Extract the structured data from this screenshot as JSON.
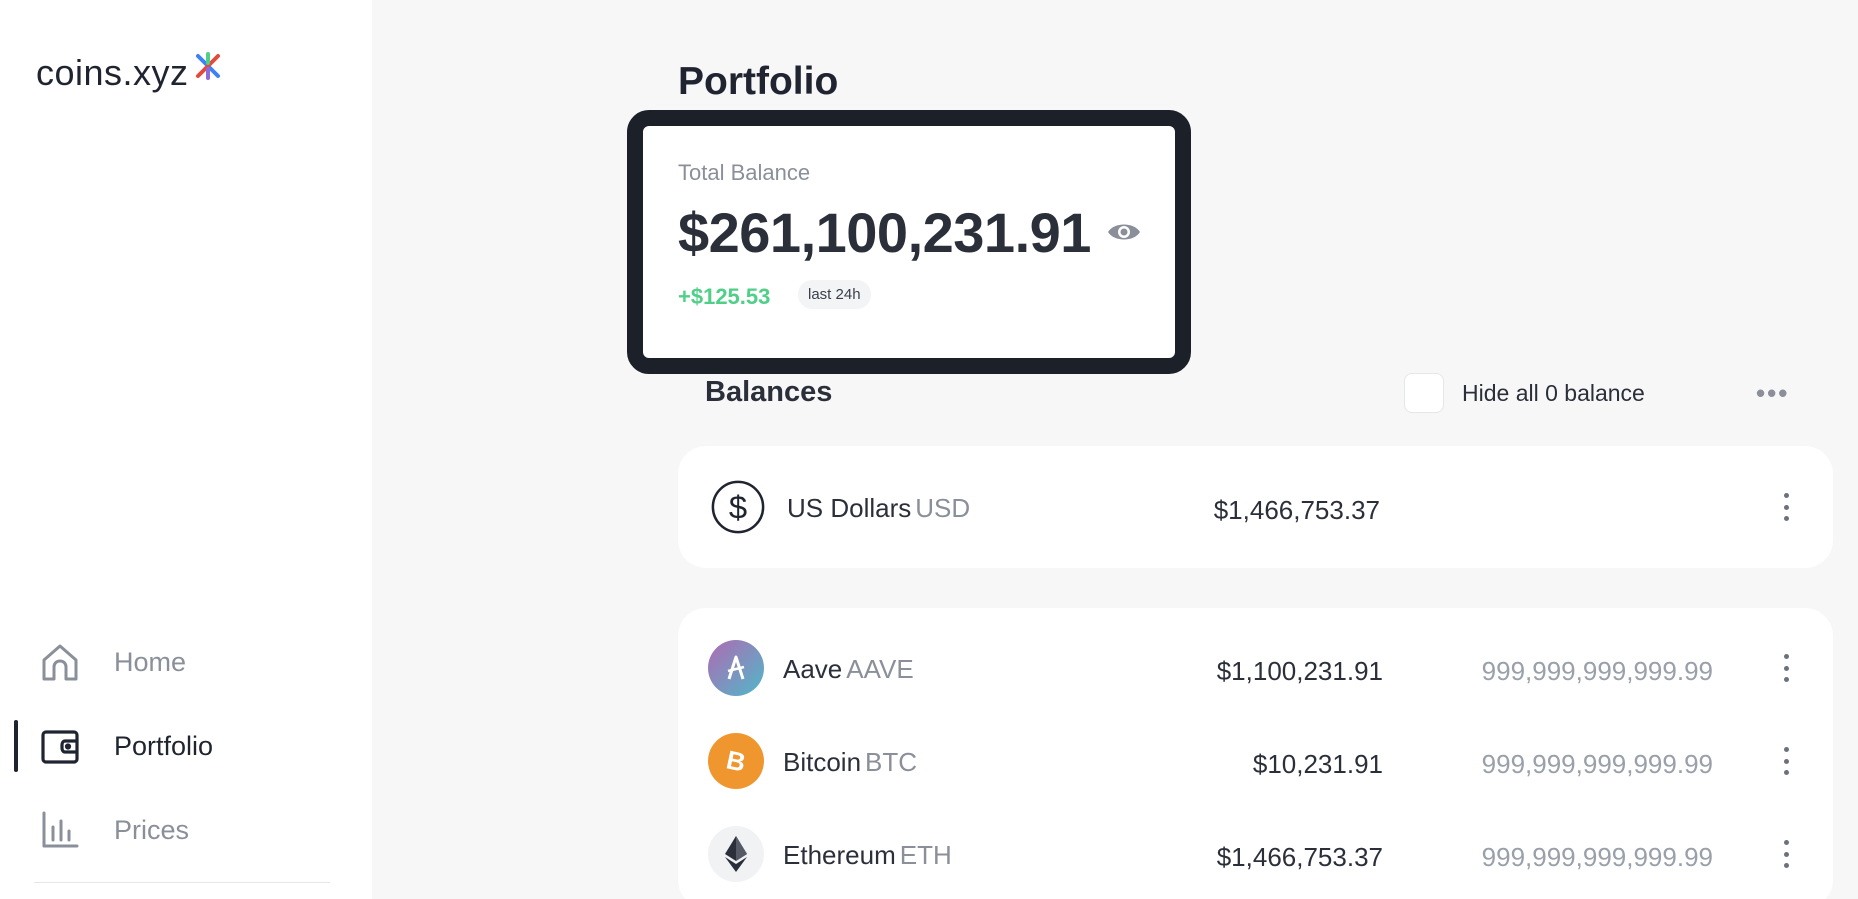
{
  "app": {
    "logo_text": "coins.xyz"
  },
  "sidebar": {
    "items": [
      {
        "label": "Home",
        "icon": "home-icon",
        "active": false
      },
      {
        "label": "Portfolio",
        "icon": "wallet-icon",
        "active": true
      },
      {
        "label": "Prices",
        "icon": "bar-chart-icon",
        "active": false
      }
    ]
  },
  "main": {
    "title": "Portfolio",
    "balance_card": {
      "label": "Total Balance",
      "amount": "$261,100,231.91",
      "change": "+$125.53",
      "change_period": "last 24h",
      "visibility_icon": "eye-icon"
    },
    "balances": {
      "title": "Balances",
      "hide_zero_label": "Hide all 0 balance",
      "more_icon": "more-horizontal-icon"
    },
    "fiat": {
      "name": "US Dollars",
      "ticker": "USD",
      "value": "$1,466,753.37",
      "icon": "dollar-circle-icon"
    },
    "assets": [
      {
        "name": "Aave",
        "ticker": "AAVE",
        "value": "$1,100,231.91",
        "quantity": "999,999,999,999.99",
        "icon": "aave-icon",
        "color": "#8f6ad9"
      },
      {
        "name": "Bitcoin",
        "ticker": "BTC",
        "value": "$10,231.91",
        "quantity": "999,999,999,999.99",
        "icon": "bitcoin-icon",
        "color": "#f0962f"
      },
      {
        "name": "Ethereum",
        "ticker": "ETH",
        "value": "$1,466,753.37",
        "quantity": "999,999,999,999.99",
        "icon": "ethereum-icon",
        "color": "#2b2f3a"
      }
    ]
  },
  "colors": {
    "accent_green": "#4fcf88",
    "text_dark": "#1f2430",
    "text_muted": "#8a8f99",
    "card_border": "#1c2029"
  }
}
